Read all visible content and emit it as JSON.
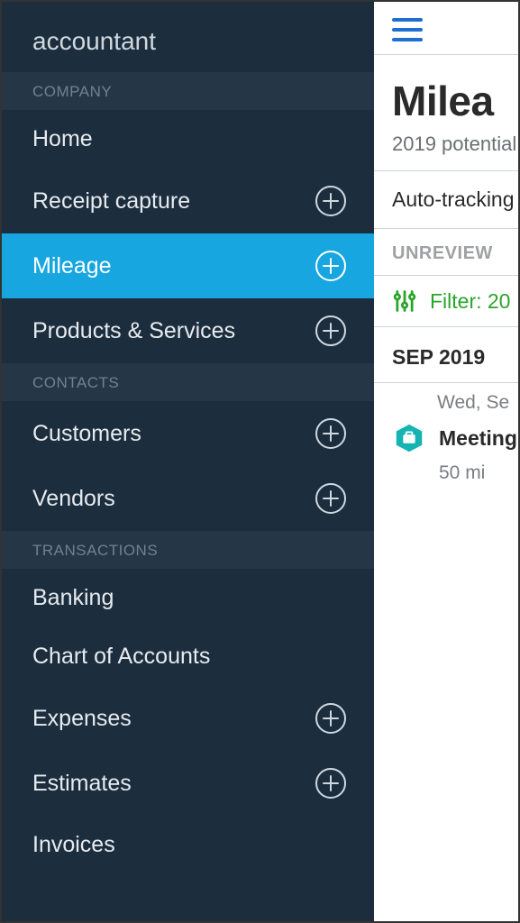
{
  "brand": "accountant",
  "sections": {
    "company": {
      "label": "COMPANY"
    },
    "contacts": {
      "label": "CONTACTS"
    },
    "transactions": {
      "label": "TRANSACTIONS"
    }
  },
  "nav": {
    "home": "Home",
    "receipt_capture": "Receipt capture",
    "mileage": "Mileage",
    "products_services": "Products & Services",
    "customers": "Customers",
    "vendors": "Vendors",
    "banking": "Banking",
    "chart_of_accounts": "Chart of Accounts",
    "expenses": "Expenses",
    "estimates": "Estimates",
    "invoices": "Invoices"
  },
  "page": {
    "title": "Milea",
    "subtitle": "2019 potential",
    "auto_tracking": "Auto-tracking",
    "tab_unreviewed": "UNREVIEW",
    "filter_label": "Filter: 20",
    "month_header": "SEP 2019",
    "trip": {
      "date": "Wed, Se",
      "title": "Meeting",
      "miles": "50 mi"
    }
  }
}
